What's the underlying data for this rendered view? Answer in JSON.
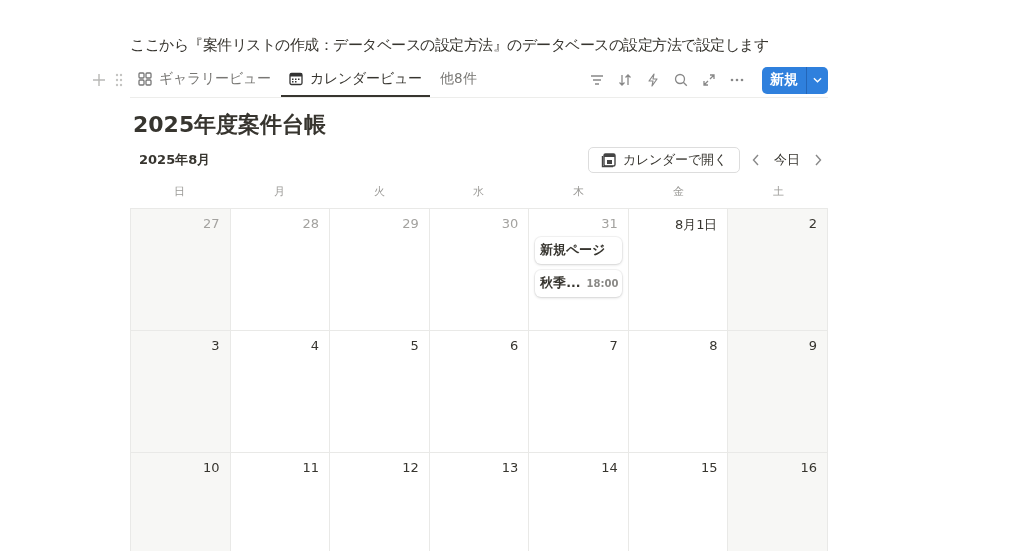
{
  "intro": "ここから『案件リストの作成：データベースの設定方法』のデータベースの設定方法で設定します",
  "tabs": [
    {
      "label": "ギャラリービュー",
      "selected": false
    },
    {
      "label": "カレンダービュー",
      "selected": true
    },
    {
      "label": "他8件",
      "selected": false
    }
  ],
  "new_button": "新規",
  "title": "2025年度案件台帳",
  "month": "2025年8月",
  "open_calendar": "カレンダーで開く",
  "today": "今日",
  "weekdays": [
    "日",
    "月",
    "火",
    "水",
    "木",
    "金",
    "土"
  ],
  "weeks": [
    [
      {
        "label": "27",
        "outside": true
      },
      {
        "label": "28",
        "outside": true
      },
      {
        "label": "29",
        "outside": true
      },
      {
        "label": "30",
        "outside": true
      },
      {
        "label": "31",
        "outside": true,
        "events": [
          {
            "title": "新規ページ"
          },
          {
            "title": "秋季...",
            "time": "18:00"
          }
        ]
      },
      {
        "label": "8月1日",
        "outside": false
      },
      {
        "label": "2",
        "outside": false
      }
    ],
    [
      {
        "label": "3",
        "outside": false
      },
      {
        "label": "4",
        "outside": false
      },
      {
        "label": "5",
        "outside": false
      },
      {
        "label": "6",
        "outside": false
      },
      {
        "label": "7",
        "outside": false
      },
      {
        "label": "8",
        "outside": false
      },
      {
        "label": "9",
        "outside": false
      }
    ],
    [
      {
        "label": "10",
        "outside": false
      },
      {
        "label": "11",
        "outside": false
      },
      {
        "label": "12",
        "outside": false
      },
      {
        "label": "13",
        "outside": false
      },
      {
        "label": "14",
        "outside": false
      },
      {
        "label": "15",
        "outside": false
      },
      {
        "label": "16",
        "outside": false
      }
    ]
  ]
}
